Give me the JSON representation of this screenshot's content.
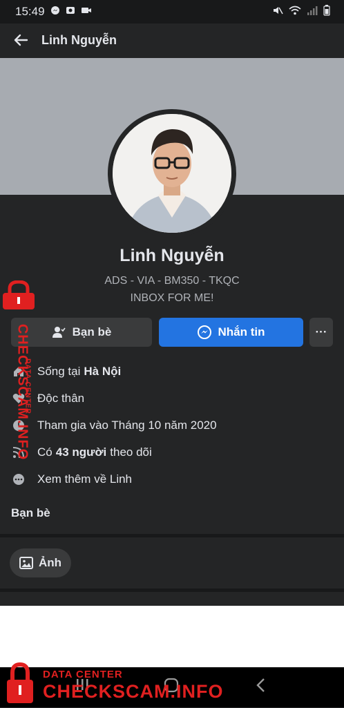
{
  "status_bar": {
    "time": "15:49"
  },
  "header": {
    "title": "Linh Nguyễn"
  },
  "profile": {
    "name": "Linh Nguyễn",
    "bio_line1": "ADS - VIA - BM350 - TKQC",
    "bio_line2": "INBOX FOR ME!"
  },
  "actions": {
    "friends_label": "Bạn bè",
    "message_label": "Nhắn tin",
    "more_label": "···"
  },
  "details": {
    "lives_prefix": "Sống tại",
    "lives_city": "Hà Nội",
    "relationship": "Độc thân",
    "joined": "Tham gia vào Tháng 10 năm 2020",
    "followers_prefix": "Có",
    "followers_count": "43 người",
    "followers_suffix": "theo dõi",
    "see_more": "Xem thêm về Linh"
  },
  "sections": {
    "friends_heading": "Bạn bè",
    "photos_label": "Ảnh"
  },
  "watermark": {
    "small": "DATA CENTER",
    "big": "CHECKSCAM.INFO"
  },
  "colors": {
    "accent": "#2374e1",
    "background": "#242526",
    "watermark": "#e02020"
  }
}
